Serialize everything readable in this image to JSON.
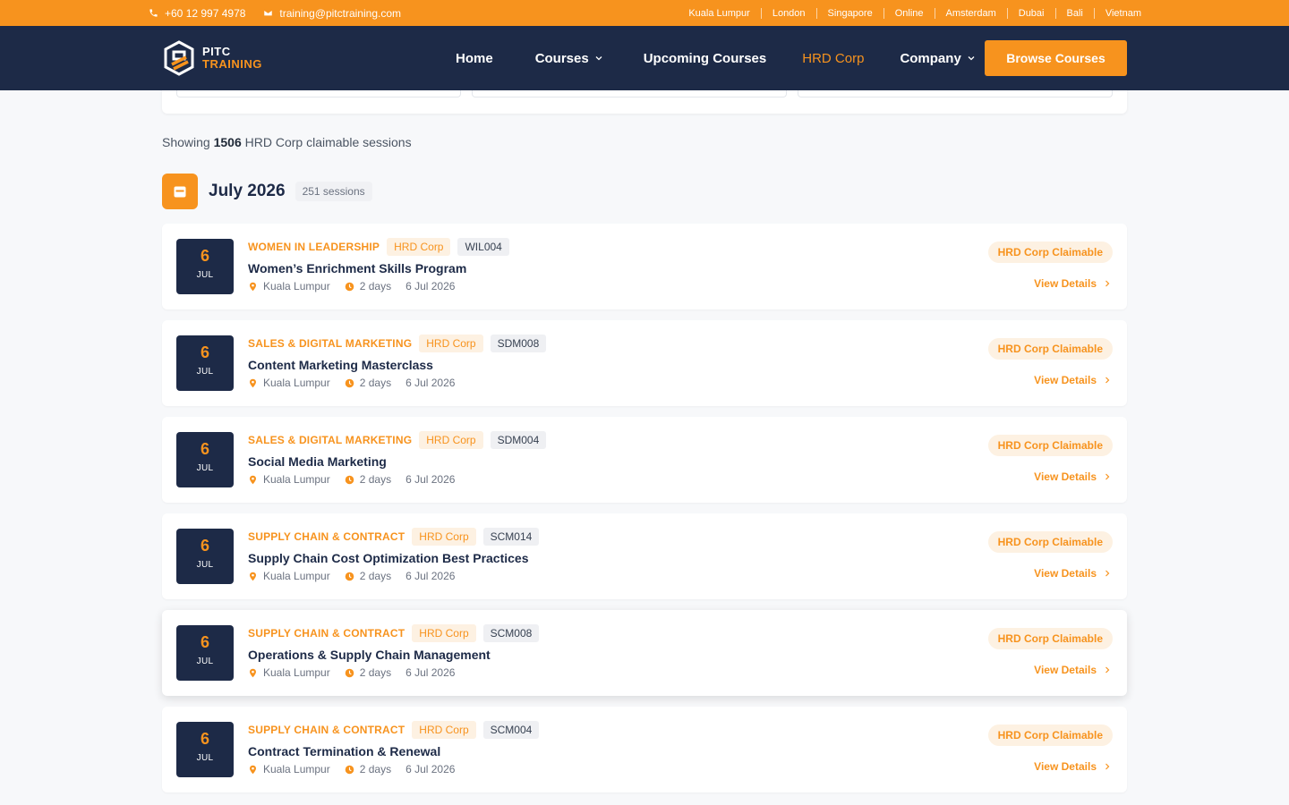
{
  "topbar": {
    "phone": "+60 12 997 4978",
    "email": "training@pitctraining.com",
    "locations": [
      "Kuala Lumpur",
      "London",
      "Singapore",
      "Online",
      "Amsterdam",
      "Dubai",
      "Bali",
      "Vietnam"
    ]
  },
  "logo": {
    "line1": "PITC",
    "line2": "TRAINING"
  },
  "nav": {
    "items": [
      {
        "label": "Home",
        "dropdown": false,
        "active": false
      },
      {
        "label": "Courses",
        "dropdown": true,
        "active": false
      },
      {
        "label": "Upcoming Courses",
        "dropdown": false,
        "active": false
      },
      {
        "label": "HRD Corp",
        "dropdown": false,
        "active": true
      },
      {
        "label": "Company",
        "dropdown": true,
        "active": false
      }
    ],
    "cta": "Browse Courses"
  },
  "summary": {
    "prefix": "Showing",
    "count": "1506",
    "suffix": "HRD Corp claimable sessions"
  },
  "month": {
    "title": "July 2026",
    "sessions": "251 sessions"
  },
  "courses": [
    {
      "day": "6",
      "mon": "JUL",
      "category": "WOMEN IN LEADERSHIP",
      "hrd": "HRD Corp",
      "code": "WIL004",
      "title": "Women’s Enrichment Skills Program",
      "location": "Kuala Lumpur",
      "duration": "2 days",
      "date": "6 Jul 2026",
      "claim": "HRD Corp Claimable",
      "details": "View Details",
      "hover": false
    },
    {
      "day": "6",
      "mon": "JUL",
      "category": "SALES & DIGITAL MARKETING",
      "hrd": "HRD Corp",
      "code": "SDM008",
      "title": "Content Marketing Masterclass",
      "location": "Kuala Lumpur",
      "duration": "2 days",
      "date": "6 Jul 2026",
      "claim": "HRD Corp Claimable",
      "details": "View Details",
      "hover": false
    },
    {
      "day": "6",
      "mon": "JUL",
      "category": "SALES & DIGITAL MARKETING",
      "hrd": "HRD Corp",
      "code": "SDM004",
      "title": "Social Media Marketing",
      "location": "Kuala Lumpur",
      "duration": "2 days",
      "date": "6 Jul 2026",
      "claim": "HRD Corp Claimable",
      "details": "View Details",
      "hover": false
    },
    {
      "day": "6",
      "mon": "JUL",
      "category": "SUPPLY CHAIN & CONTRACT",
      "hrd": "HRD Corp",
      "code": "SCM014",
      "title": "Supply Chain Cost Optimization Best Practices",
      "location": "Kuala Lumpur",
      "duration": "2 days",
      "date": "6 Jul 2026",
      "claim": "HRD Corp Claimable",
      "details": "View Details",
      "hover": false
    },
    {
      "day": "6",
      "mon": "JUL",
      "category": "SUPPLY CHAIN & CONTRACT",
      "hrd": "HRD Corp",
      "code": "SCM008",
      "title": "Operations & Supply Chain Management",
      "location": "Kuala Lumpur",
      "duration": "2 days",
      "date": "6 Jul 2026",
      "claim": "HRD Corp Claimable",
      "details": "View Details",
      "hover": true
    },
    {
      "day": "6",
      "mon": "JUL",
      "category": "SUPPLY CHAIN & CONTRACT",
      "hrd": "HRD Corp",
      "code": "SCM004",
      "title": "Contract Termination & Renewal",
      "location": "Kuala Lumpur",
      "duration": "2 days",
      "date": "6 Jul 2026",
      "claim": "HRD Corp Claimable",
      "details": "View Details",
      "hover": false
    }
  ],
  "colors": {
    "brand_orange": "#f7931e",
    "navy": "#1d2a47"
  }
}
